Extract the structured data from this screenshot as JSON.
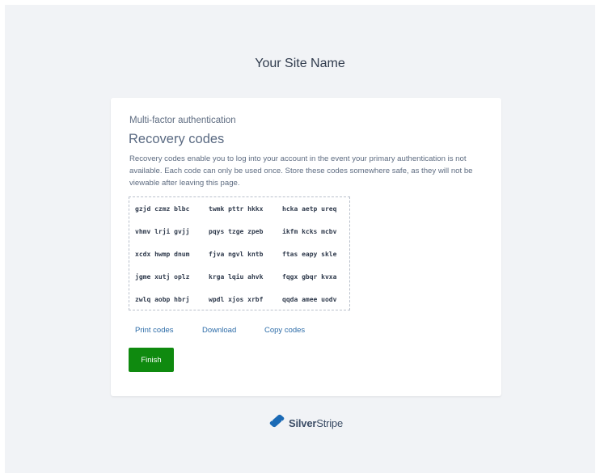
{
  "site": {
    "name": "Your Site Name"
  },
  "card": {
    "kicker": "Multi-factor authentication",
    "title": "Recovery codes",
    "description": "Recovery codes enable you to log into your account in the event your primary authentication is not available. Each code can only be used once. Store these codes somewhere safe, as they will not be viewable after leaving this page."
  },
  "codes": [
    [
      "gzjd czmz blbc",
      "twmk pttr hkkx",
      "hcka aetp ureq"
    ],
    [
      "vhmv lrji gvjj",
      "pqys tzge zpeb",
      "ikfm kcks mcbv"
    ],
    [
      "xcdx hwmp dnum",
      "fjva ngvl kntb",
      "ftas eapy skle"
    ],
    [
      "jgme xutj oplz",
      "krga lqiu ahvk",
      "fqgx gbqr kvxa"
    ],
    [
      "zwlq aobp hbrj",
      "wpdl xjos xrbf",
      "qqda amee uodv"
    ]
  ],
  "actions": {
    "print": "Print codes",
    "download": "Download",
    "copy": "Copy codes"
  },
  "finish_label": "Finish",
  "footer": {
    "logo_icon": "silverstripe-logo-icon",
    "logo_text_bold": "Silver",
    "logo_text_regular": "Stripe"
  },
  "colors": {
    "background": "#f1f3f6",
    "card": "#ffffff",
    "link": "#2d6ca8",
    "finish_button": "#0f8a0f",
    "brand_blue": "#1b6ab5"
  }
}
